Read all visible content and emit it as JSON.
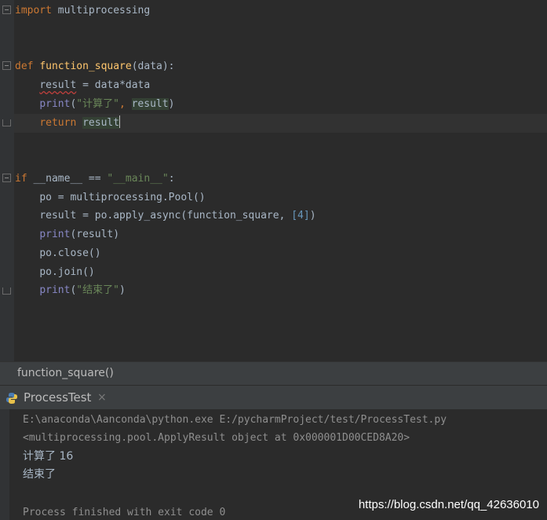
{
  "code": {
    "line1": {
      "kw": "import",
      "rest": " multiprocessing"
    },
    "line4": {
      "kw": "def",
      "fn": "function_square",
      "rest": "(data):"
    },
    "line5": {
      "var": "result",
      "rest": " = data*data"
    },
    "line6": {
      "fn": "print",
      "open": "(",
      "str": "\"计算了\"",
      "comma": ", ",
      "arg": "result",
      "close": ")"
    },
    "line7": {
      "kw": "return",
      "arg": "result"
    },
    "line10": {
      "kw": "if",
      "mid": " __name__ == ",
      "str": "\"__main__\"",
      "end": ":"
    },
    "line11": {
      "text": "po = multiprocessing.Pool()"
    },
    "line12": {
      "pre": "result = po.apply_async(function_square, ",
      "num": "[4]",
      "post": ")"
    },
    "line13": {
      "fn": "print",
      "rest": "(result)"
    },
    "line14": {
      "text": "po.close()"
    },
    "line15": {
      "text": "po.join()"
    },
    "line16": {
      "fn": "print",
      "open": "(",
      "str": "\"结束了\"",
      "close": ")"
    }
  },
  "breadcrumb": {
    "label": "function_square()"
  },
  "run": {
    "tab_title": "ProcessTest",
    "close_glyph": "×",
    "icon": "python-icon"
  },
  "console": {
    "lines": [
      "E:\\anaconda\\Aanconda\\python.exe E:/pycharmProject/test/ProcessTest.py",
      "<multiprocessing.pool.ApplyResult object at 0x000001D00CED8A20>",
      "计算了 16",
      "结束了",
      "Process finished with exit code 0"
    ]
  },
  "watermark": "https://blog.csdn.net/qq_42636010"
}
